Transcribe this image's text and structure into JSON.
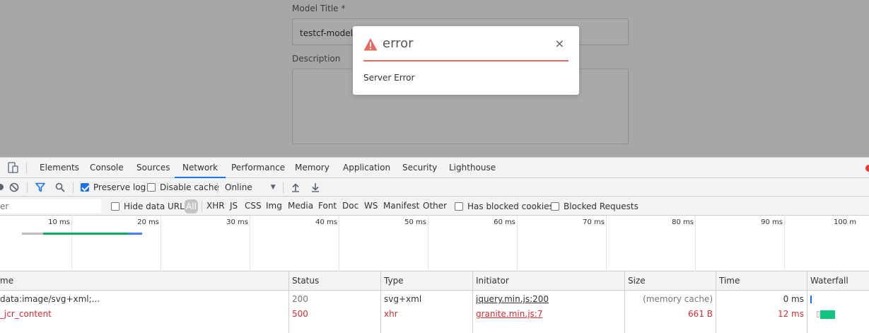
{
  "form": {
    "title_label": "Model Title *",
    "title_value": "testcf-model",
    "description_label": "Description"
  },
  "modal": {
    "title": "error",
    "close_glyph": "×",
    "message": "Server Error",
    "accent_color": "#e86a5f"
  },
  "devtools": {
    "tabs": [
      "Elements",
      "Console",
      "Sources",
      "Network",
      "Performance",
      "Memory",
      "Application",
      "Security",
      "Lighthouse"
    ],
    "active_tab": "Network",
    "toolbar": {
      "preserve_log_label": "Preserve log",
      "preserve_log_checked": true,
      "disable_cache_label": "Disable cache",
      "disable_cache_checked": false,
      "throttle_value": "Online"
    },
    "filter": {
      "placeholder_fragment": "er",
      "hide_data_urls_label": "Hide data URLs",
      "types": [
        "All",
        "XHR",
        "JS",
        "CSS",
        "Img",
        "Media",
        "Font",
        "Doc",
        "WS",
        "Manifest",
        "Other"
      ],
      "has_blocked_cookies_label": "Has blocked cookies",
      "blocked_requests_label": "Blocked Requests"
    },
    "overview_ticks": [
      "10 ms",
      "20 ms",
      "30 ms",
      "40 ms",
      "50 ms",
      "60 ms",
      "70 ms",
      "80 ms",
      "90 ms",
      "100 m"
    ],
    "columns": [
      "me",
      "Status",
      "Type",
      "Initiator",
      "Size",
      "Time",
      "Waterfall"
    ],
    "rows": [
      {
        "name": "data:image/svg+xml;...",
        "status": "200",
        "type": "svg+xml",
        "initiator": "jquery.min.js:200",
        "size": "(memory cache)",
        "time": "0 ms"
      },
      {
        "name": "_jcr_content",
        "status": "500",
        "type": "xhr",
        "initiator": "granite.min.js:7",
        "size": "661 B",
        "time": "12 ms"
      }
    ]
  }
}
